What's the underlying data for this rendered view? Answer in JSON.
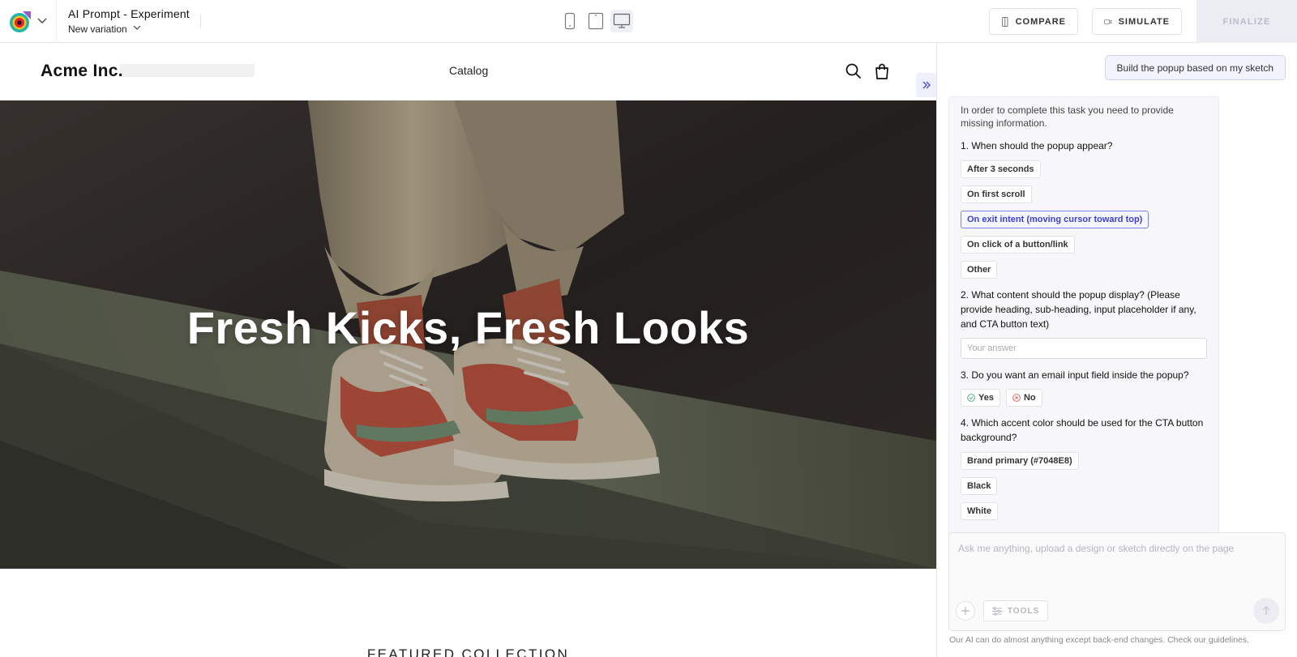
{
  "topbar": {
    "project_title": "AI Prompt - Experiment",
    "variation_label": "New variation",
    "compare_label": "COMPARE",
    "simulate_label": "SIMULATE",
    "finalize_label": "FINALIZE",
    "devices": [
      "mobile",
      "tablet",
      "desktop"
    ],
    "active_device": "desktop"
  },
  "preview": {
    "brand": "Acme Inc.",
    "nav": [
      "Catalog"
    ],
    "hero_title": "Fresh Kicks, Fresh Looks",
    "featured_heading": "FEATURED COLLECTION"
  },
  "panel": {
    "user_message": "Build the popup based on my sketch",
    "ai_intro": "In order to complete this task you need to provide missing information.",
    "q1": {
      "question": "1. When should the popup appear?",
      "options": [
        "After 3 seconds",
        "On first scroll",
        "On exit intent (moving cursor toward top)",
        "On click of a button/link",
        "Other"
      ],
      "selected": "On exit intent (moving cursor toward top)"
    },
    "q2": {
      "question": "2. What content should the popup display? (Please provide heading, sub-heading, input placeholder if any, and CTA button text)",
      "placeholder": "Your answer"
    },
    "q3": {
      "question": "3. Do you want an email input field inside the popup?",
      "yes": "Yes",
      "no": "No"
    },
    "q4": {
      "question": "4. Which accent color should be used for the CTA button background?",
      "options": [
        "Brand primary (#7048E8)",
        "Black",
        "White"
      ]
    },
    "composer_placeholder": "Ask me anything, upload a design or sketch directly on the page",
    "tools_label": "TOOLS",
    "disclaimer": "Our AI can do almost anything except back-end changes. Check our guidelines."
  },
  "colors": {
    "accent": "#3b3fd6",
    "selected_border": "#7b83e8",
    "finalize_bg": "#ecedf2"
  }
}
